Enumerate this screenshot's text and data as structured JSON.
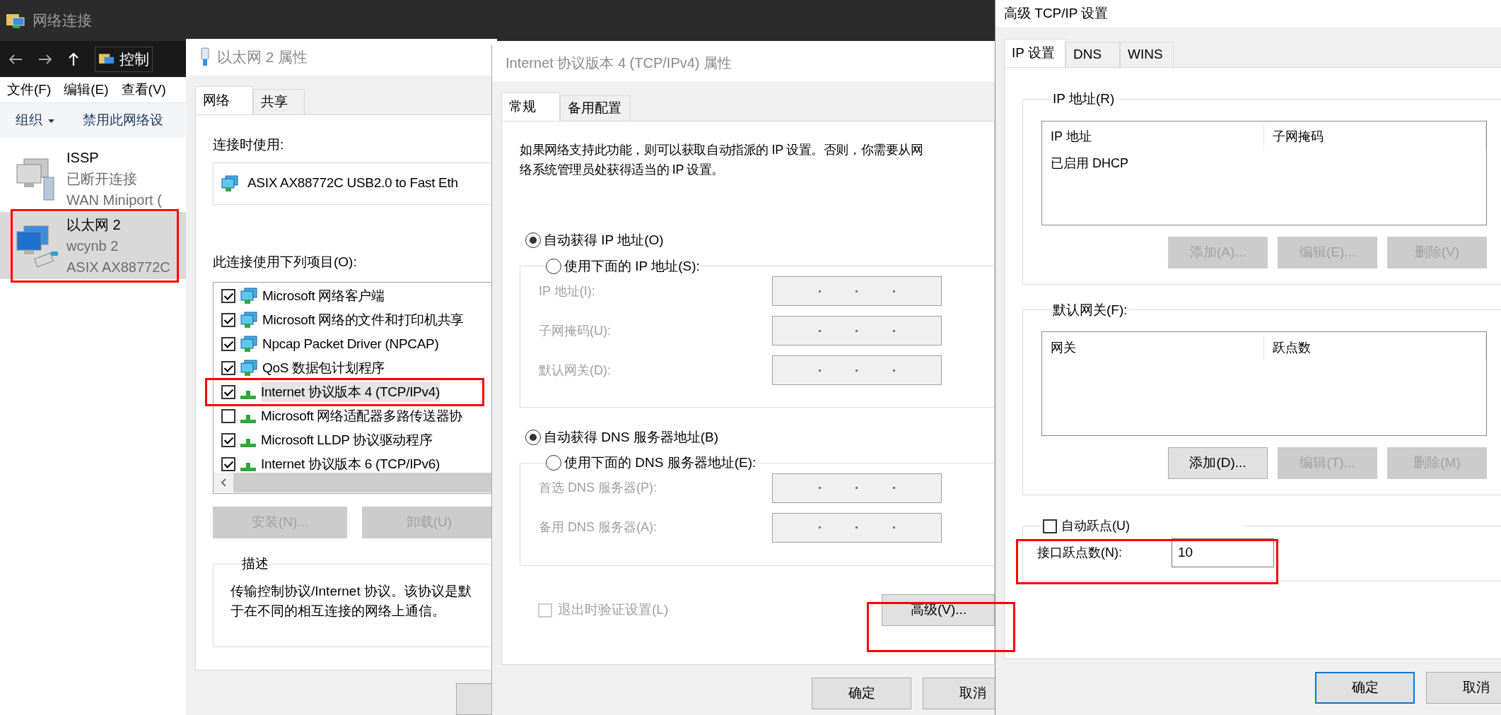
{
  "explorer": {
    "title": "网络连接",
    "address": "控制",
    "menu": [
      "文件(F)",
      "编辑(E)",
      "查看(V)"
    ],
    "toolbar": [
      {
        "label": "组织",
        "dropdown": true
      },
      {
        "label": "禁用此网络设",
        "dropdown": false
      }
    ],
    "connections": [
      {
        "name": "ISSP",
        "status": "已断开连接",
        "device": "WAN Miniport (",
        "kind": "dialup",
        "selected": false,
        "annotated": false
      },
      {
        "name": "以太网 2",
        "status": "wcynb 2",
        "device": "ASIX AX88772C",
        "kind": "ethernet",
        "selected": true,
        "annotated": true
      }
    ]
  },
  "adapter_properties": {
    "title": "以太网 2 属性",
    "tabs": [
      {
        "label": "网络",
        "selected": true
      },
      {
        "label": "共享",
        "selected": false
      }
    ],
    "connect_using_label": "连接时使用:",
    "adapter": "ASIX AX88772C USB2.0 to Fast Eth",
    "items_label": "此连接使用下列项目(O):",
    "items": [
      {
        "label": "Microsoft 网络客户端",
        "checked": true,
        "kind": "client",
        "selected": false,
        "annotated": false
      },
      {
        "label": "Microsoft 网络的文件和打印机共享",
        "checked": true,
        "kind": "service",
        "selected": false,
        "annotated": false
      },
      {
        "label": "Npcap Packet Driver (NPCAP)",
        "checked": true,
        "kind": "service",
        "selected": false,
        "annotated": false
      },
      {
        "label": "QoS 数据包计划程序",
        "checked": true,
        "kind": "service",
        "selected": false,
        "annotated": false
      },
      {
        "label": "Internet 协议版本 4 (TCP/IPv4)",
        "checked": true,
        "kind": "protocol",
        "selected": true,
        "annotated": true
      },
      {
        "label": "Microsoft 网络适配器多路传送器协",
        "checked": false,
        "kind": "protocol",
        "selected": false,
        "annotated": false
      },
      {
        "label": "Microsoft LLDP 协议驱动程序",
        "checked": true,
        "kind": "protocol",
        "selected": false,
        "annotated": false
      },
      {
        "label": "Internet 协议版本 6 (TCP/IPv6)",
        "checked": true,
        "kind": "protocol",
        "selected": false,
        "annotated": false
      }
    ],
    "buttons": [
      {
        "label": "安装(N)...",
        "disabled": true
      },
      {
        "label": "卸载(U)",
        "disabled": true
      }
    ],
    "description": {
      "title": "描述",
      "lines": [
        "传输控制协议/Internet 协议。该协议是默",
        "于在不同的相互连接的网络上通信。"
      ]
    }
  },
  "ipv4_properties": {
    "title": "Internet 协议版本 4 (TCP/IPv4) 属性",
    "tabs": [
      {
        "label": "常规",
        "selected": true
      },
      {
        "label": "备用配置",
        "selected": false
      }
    ],
    "intro_lines": [
      "如果网络支持此功能，则可以获取自动指派的 IP 设置。否则，你需要从网",
      "络系统管理员处获得适当的 IP 设置。"
    ],
    "ip_options": [
      {
        "label": "自动获得 IP 地址(O)",
        "selected": true
      },
      {
        "label": "使用下面的 IP 地址(S):",
        "selected": false
      }
    ],
    "ip_fields": [
      {
        "label": "IP 地址(I):",
        "disabled": true
      },
      {
        "label": "子网掩码(U):",
        "disabled": true
      },
      {
        "label": "默认网关(D):",
        "disabled": true
      }
    ],
    "dns_options": [
      {
        "label": "自动获得 DNS 服务器地址(B)",
        "selected": true
      },
      {
        "label": "使用下面的 DNS 服务器地址(E):",
        "selected": false
      }
    ],
    "dns_fields": [
      {
        "label": "首选 DNS 服务器(P):",
        "disabled": true
      },
      {
        "label": "备用 DNS 服务器(A):",
        "disabled": true
      }
    ],
    "validate": {
      "label": "退出时验证设置(L)",
      "checked": false,
      "disabled": true
    },
    "advanced_button": {
      "label": "高级(V)...",
      "annotated": true
    },
    "buttons": [
      {
        "label": "确定",
        "default": false
      },
      {
        "label": "取消",
        "default": false
      }
    ]
  },
  "advanced_tcpip": {
    "title": "高级 TCP/IP 设置",
    "tabs": [
      {
        "label": "IP 设置",
        "selected": true
      },
      {
        "label": "DNS",
        "selected": false
      },
      {
        "label": "WINS",
        "selected": false
      }
    ],
    "ip_group": {
      "title": "IP 地址(R)",
      "columns": [
        "IP 地址",
        "子网掩码"
      ],
      "rows": [
        [
          "已启用 DHCP"
        ]
      ],
      "buttons": [
        {
          "label": "添加(A)...",
          "disabled": true
        },
        {
          "label": "编辑(E)...",
          "disabled": true
        },
        {
          "label": "删除(V)",
          "disabled": true
        }
      ]
    },
    "gateway_group": {
      "title": "默认网关(F):",
      "columns": [
        "网关",
        "跃点数"
      ],
      "buttons": [
        {
          "label": "添加(D)...",
          "disabled": false
        },
        {
          "label": "编辑(T)...",
          "disabled": true
        },
        {
          "label": "删除(M)",
          "disabled": true
        }
      ]
    },
    "auto_metric": {
      "label": "自动跃点(U)",
      "checked": false
    },
    "metric": {
      "label": "接口跃点数(N):",
      "value": "10",
      "annotated": true
    },
    "buttons": [
      {
        "label": "确定",
        "default": true
      },
      {
        "label": "取消",
        "default": false
      }
    ]
  }
}
